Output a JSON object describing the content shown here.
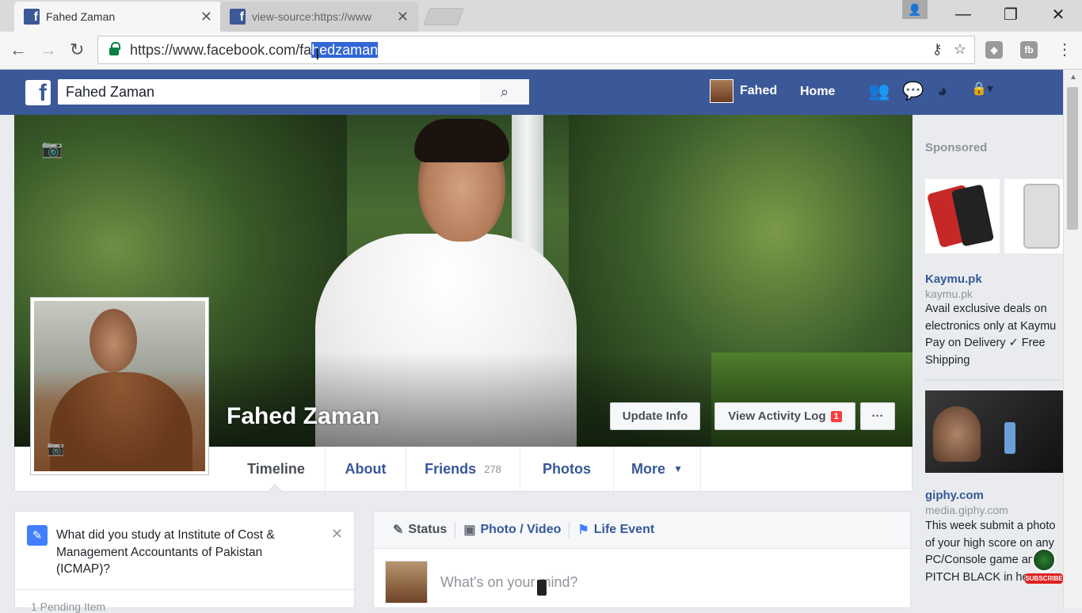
{
  "browser": {
    "tabs": [
      {
        "title": "Fahed Zaman",
        "close": "✕"
      },
      {
        "title": "view-source:https://www",
        "close": "✕"
      }
    ],
    "url_prefix": "https://www.facebook.com/fa",
    "url_selected": "hedzaman",
    "window_buttons": [
      "—",
      "❐",
      "✕"
    ]
  },
  "fb": {
    "logo": "f",
    "search_value": "Fahed Zaman",
    "user_name": "Fahed",
    "home": "Home"
  },
  "profile": {
    "name": "Fahed Zaman",
    "update_info": "Update Info",
    "view_activity_log": "View Activity Log",
    "activity_badge": "1",
    "more_dots": "···"
  },
  "tabs": {
    "timeline": "Timeline",
    "about": "About",
    "friends": "Friends",
    "friends_count": "278",
    "photos": "Photos",
    "more": "More",
    "more_caret": "▼"
  },
  "left_card": {
    "question": "What did you study at Institute of Cost & Management Accountants of Pakistan (ICMAP)?",
    "close": "✕",
    "pending": "1 Pending Item"
  },
  "composer": {
    "status": "Status",
    "photo_video": "Photo / Video",
    "life_event": "Life Event",
    "placeholder": "What's on your mind?"
  },
  "sidebar": {
    "sponsored": "Sponsored",
    "ads": [
      {
        "title": "Kaymu.pk",
        "domain": "kaymu.pk",
        "text": "Avail exclusive deals on electronics only at Kaymu Pay on Delivery ✓ Free Shipping"
      },
      {
        "title": "giphy.com",
        "domain": "media.giphy.com",
        "text": "This week submit a photo of your high score on any PC/Console game and PITCH BLACK in here."
      }
    ]
  },
  "watermark": {
    "label": "SUBSCRIBE"
  }
}
